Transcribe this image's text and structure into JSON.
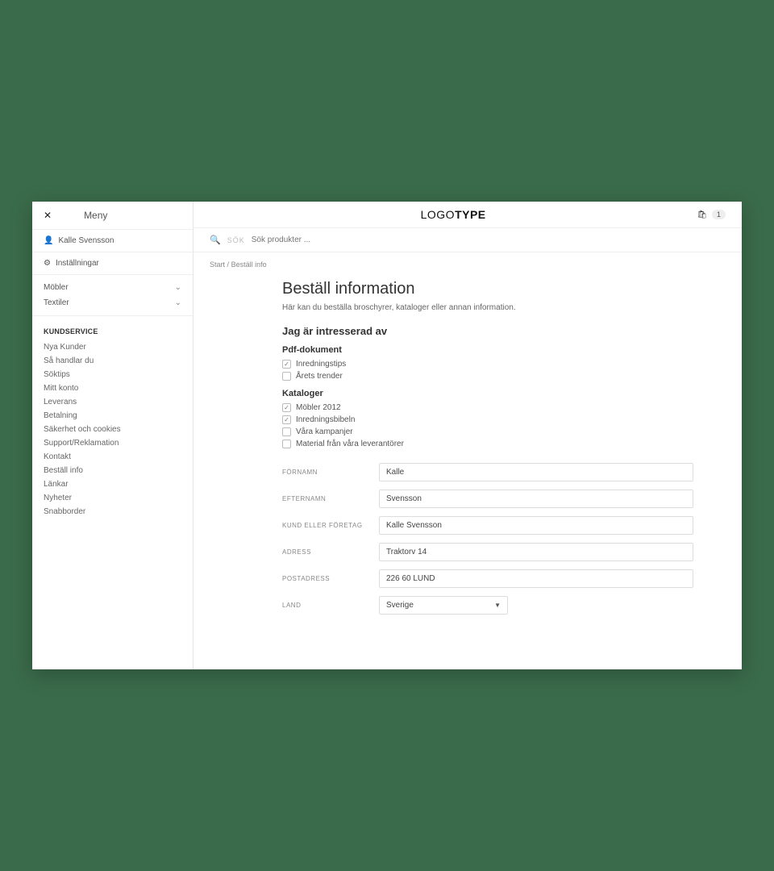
{
  "sidebar": {
    "menu_title": "Meny",
    "user_name": "Kalle Svensson",
    "settings_label": "Inställningar",
    "categories": [
      {
        "label": "Möbler"
      },
      {
        "label": "Textiler"
      }
    ],
    "kundservice_heading": "KUNDSERVICE",
    "kundservice_items": [
      "Nya Kunder",
      "Så handlar du",
      "Söktips",
      "Mitt konto",
      "Leverans",
      "Betalning",
      "Säkerhet och cookies",
      "Support/Reklamation",
      "Kontakt",
      "Beställ info",
      "Länkar",
      "Nyheter",
      "Snabborder"
    ]
  },
  "header": {
    "logo_light": "LOGO",
    "logo_bold": "TYPE",
    "cart_count": "1"
  },
  "search": {
    "sok": "SÖK",
    "placeholder": "Sök produkter ..."
  },
  "breadcrumb": {
    "start": "Start",
    "sep": "/",
    "current": "Beställ info"
  },
  "page": {
    "title": "Beställ information",
    "subtitle": "Här kan du beställa broschyrer, kataloger eller annan information.",
    "interest_heading": "Jag är intresserad av",
    "pdf_heading": "Pdf-dokument",
    "pdf_items": [
      {
        "label": "Inredningstips",
        "checked": true
      },
      {
        "label": "Årets trender",
        "checked": false
      }
    ],
    "katalog_heading": "Kataloger",
    "katalog_items": [
      {
        "label": "Möbler 2012",
        "checked": true
      },
      {
        "label": "Inredningsbibeln",
        "checked": true
      },
      {
        "label": "Våra kampanjer",
        "checked": false
      },
      {
        "label": "Material från våra leverantörer",
        "checked": false
      }
    ],
    "form": {
      "fornamn_label": "FÖRNAMN",
      "fornamn_value": "Kalle",
      "efternamn_label": "EFTERNAMN",
      "efternamn_value": "Svensson",
      "kund_label": "KUND ELLER FÖRETAG",
      "kund_value": "Kalle Svensson",
      "adress_label": "ADRESS",
      "adress_value": "Traktorv 14",
      "postadress_label": "POSTADRESS",
      "postadress_value": "226 60 LUND",
      "land_label": "LAND",
      "land_value": "Sverige"
    }
  }
}
